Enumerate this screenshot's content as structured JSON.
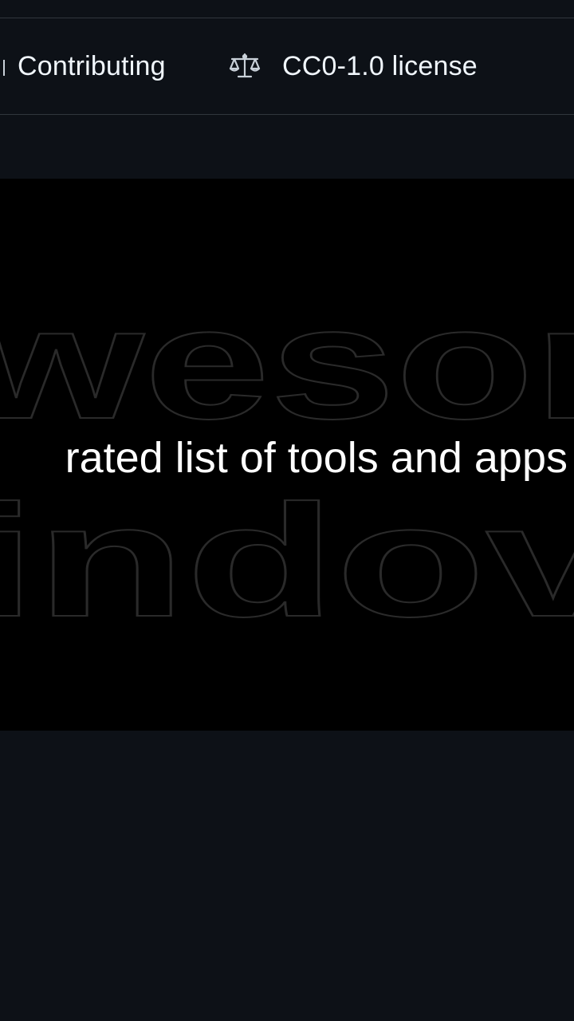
{
  "tabs": {
    "contributing_label": "Contributing",
    "license_label": "CC0-1.0 license",
    "license_icon": "law-scale-icon"
  },
  "banner": {
    "outline_line1": "wesor",
    "outline_line2": "indov",
    "tagline": "rated list of tools and apps"
  },
  "colors": {
    "page_bg": "#0d1117",
    "banner_bg": "#000000",
    "text": "#f0f6fc",
    "border": "#30363d",
    "outline_stroke": "#2a2a2a"
  }
}
